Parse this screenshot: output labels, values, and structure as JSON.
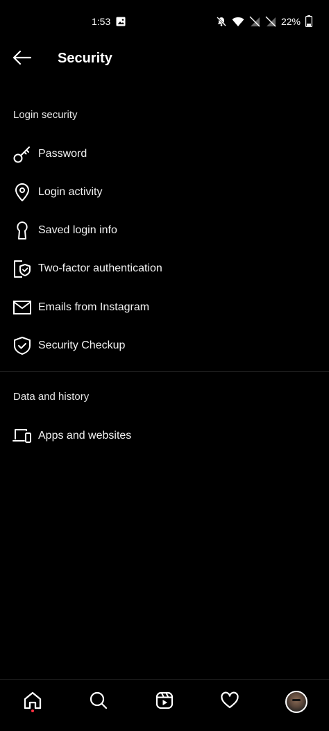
{
  "status_bar": {
    "time": "1:53",
    "battery": "22%",
    "icons": [
      "image-icon",
      "bell-off-icon",
      "wifi-icon",
      "no-sim-icon",
      "no-sim-icon",
      "battery-icon"
    ]
  },
  "header": {
    "title": "Security",
    "back_icon": "arrow-left-icon"
  },
  "sections": [
    {
      "title": "Login security",
      "items": [
        {
          "label": "Password",
          "icon": "key-icon"
        },
        {
          "label": "Login activity",
          "icon": "location-pin-icon"
        },
        {
          "label": "Saved login info",
          "icon": "keyhole-icon"
        },
        {
          "label": "Two-factor authentication",
          "icon": "two-factor-shield-icon"
        },
        {
          "label": "Emails from Instagram",
          "icon": "envelope-icon"
        },
        {
          "label": "Security Checkup",
          "icon": "shield-check-icon"
        }
      ]
    },
    {
      "title": "Data and history",
      "items": [
        {
          "label": "Apps and websites",
          "icon": "devices-icon"
        }
      ]
    }
  ],
  "bottom_nav": {
    "items": [
      "home-icon",
      "search-icon",
      "reels-icon",
      "heart-icon",
      "profile-avatar"
    ],
    "active": "home-icon",
    "notification_dot_color": "#ff3040"
  }
}
